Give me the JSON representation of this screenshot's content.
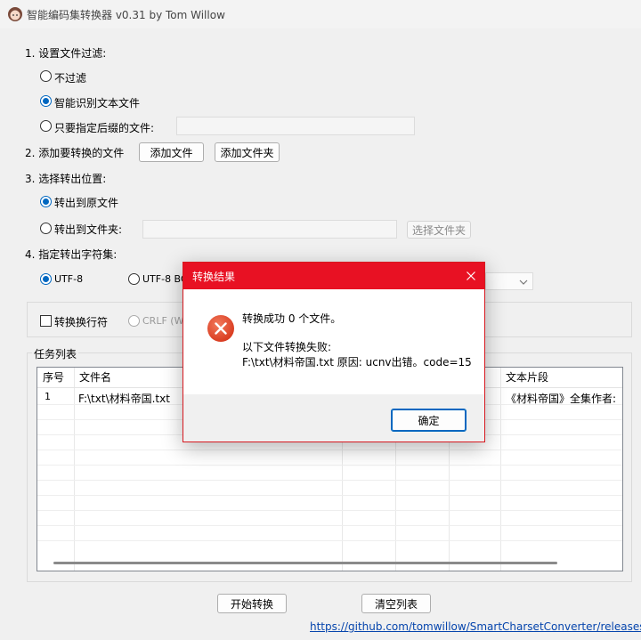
{
  "window": {
    "title": "智能编码集转换器 v0.31 by Tom Willow"
  },
  "step1": {
    "label": "1. 设置文件过滤:",
    "options": [
      {
        "label": "不过滤",
        "selected": false
      },
      {
        "label": "智能识别文本文件",
        "selected": true
      },
      {
        "label": "只要指定后缀的文件:",
        "selected": false
      }
    ],
    "suffix_value": ""
  },
  "step2": {
    "label": "2. 添加要转换的文件",
    "add_file_button": "添加文件",
    "add_folder_button": "添加文件夹"
  },
  "step3": {
    "label": "3. 选择转出位置:",
    "options": [
      {
        "label": "转出到原文件",
        "selected": true
      },
      {
        "label": "转出到文件夹:",
        "selected": false
      }
    ],
    "folder_value": "",
    "choose_folder_button": "选择文件夹"
  },
  "step4": {
    "label": "4. 指定转出字符集:",
    "options": [
      {
        "label": "UTF-8",
        "selected": true
      },
      {
        "label": "UTF-8 BO",
        "selected": false
      }
    ],
    "combo_value": ""
  },
  "linebreak": {
    "checkbox_label": "转换换行符",
    "checked": false,
    "crlf_label": "CRLF (Wi"
  },
  "tasks": {
    "group_label": "任务列表",
    "columns": [
      "序号",
      "文件名",
      "",
      "",
      "",
      "文本片段"
    ],
    "rows": [
      {
        "index": "1",
        "filename": "F:\\txt\\材料帝国.txt",
        "snippet": "《材料帝国》全集作者:"
      }
    ]
  },
  "footer": {
    "start_button": "开始转换",
    "clear_button": "清空列表",
    "link": "https://github.com/tomwillow/SmartCharsetConverter/releases"
  },
  "dialog": {
    "title": "转换结果",
    "line1": "转换成功 0 个文件。",
    "line2": "以下文件转换失败:",
    "line3": "F:\\txt\\材料帝国.txt 原因: ucnv出错。code=15",
    "ok_button": "确定"
  },
  "colors": {
    "accent": "#0067c0",
    "dialog_title": "#e81123",
    "error_icon": "#e0482b",
    "link": "#0645ad"
  },
  "icons": {
    "app": "anime-avatar-icon",
    "dialog_close": "close-icon",
    "error": "error-x-icon",
    "combo": "chevron-down-icon"
  }
}
